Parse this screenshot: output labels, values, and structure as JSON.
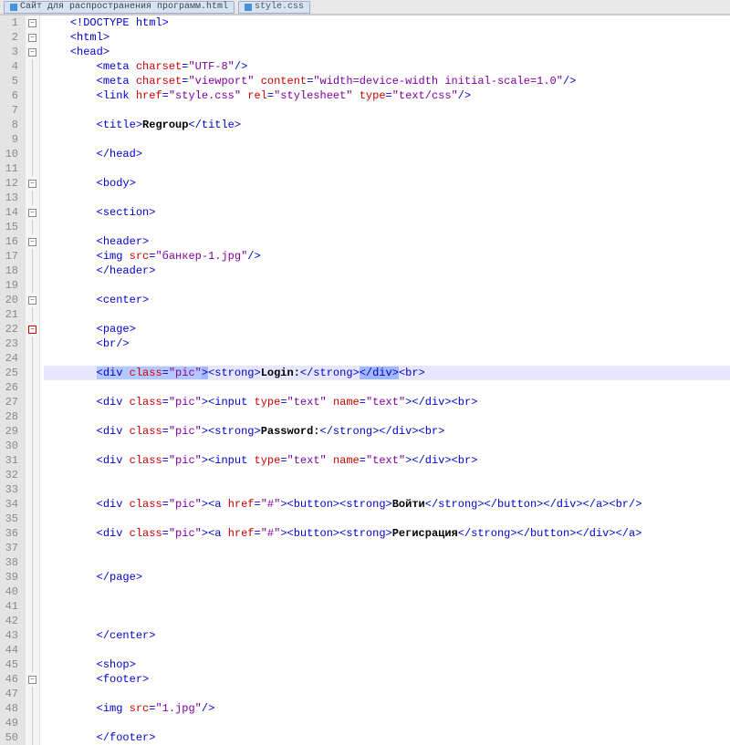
{
  "tabs": [
    {
      "label": "Сайт для распространения программ.html",
      "active": false
    },
    {
      "label": "style.css",
      "active": true
    }
  ],
  "lineStart": 1,
  "lineEnd": 50,
  "highlightedLine": 25,
  "foldMarkers": {
    "1": "expand",
    "2": "expand",
    "3": "expand",
    "12": "expand",
    "14": "expand",
    "16": "expand",
    "20": "expand",
    "22": "collapse",
    "46": "expand"
  },
  "selection": {
    "line": 25,
    "segments": [
      "<div",
      " ",
      "class",
      "=",
      "\"pic\"",
      ">",
      "</div>"
    ]
  },
  "code": [
    {
      "n": 1,
      "tokens": [
        [
          "tag",
          "<!DOCTYPE html>"
        ]
      ],
      "indent": 0
    },
    {
      "n": 2,
      "tokens": [
        [
          "tag",
          "<html>"
        ]
      ],
      "indent": 0
    },
    {
      "n": 3,
      "tokens": [
        [
          "tag",
          "<head>"
        ]
      ],
      "indent": 0
    },
    {
      "n": 4,
      "tokens": [
        [
          "tag",
          "<meta "
        ],
        [
          "attr",
          "charset"
        ],
        [
          "tag",
          "="
        ],
        [
          "str",
          "\"UTF-8\""
        ],
        [
          "tag",
          "/>"
        ]
      ],
      "indent": 2
    },
    {
      "n": 5,
      "tokens": [
        [
          "tag",
          "<meta "
        ],
        [
          "attr",
          "charset"
        ],
        [
          "tag",
          "="
        ],
        [
          "str",
          "\"viewport\" "
        ],
        [
          "attr",
          "content"
        ],
        [
          "tag",
          "="
        ],
        [
          "str",
          "\"width=device-width initial-scale=1.0\""
        ],
        [
          "tag",
          "/>"
        ]
      ],
      "indent": 2
    },
    {
      "n": 6,
      "tokens": [
        [
          "tag",
          "<link "
        ],
        [
          "attr",
          "href"
        ],
        [
          "tag",
          "="
        ],
        [
          "str",
          "\"style.css\" "
        ],
        [
          "attr",
          "rel"
        ],
        [
          "tag",
          "="
        ],
        [
          "str",
          "\"stylesheet\" "
        ],
        [
          "attr",
          "type"
        ],
        [
          "tag",
          "="
        ],
        [
          "str",
          "\"text/css\""
        ],
        [
          "tag",
          "/>"
        ]
      ],
      "indent": 2
    },
    {
      "n": 7,
      "tokens": [],
      "indent": 0
    },
    {
      "n": 8,
      "tokens": [
        [
          "tag",
          "<title>"
        ],
        [
          "txt",
          "Regroup"
        ],
        [
          "tag",
          "</title>"
        ]
      ],
      "indent": 2
    },
    {
      "n": 9,
      "tokens": [],
      "indent": 0
    },
    {
      "n": 10,
      "tokens": [
        [
          "tag",
          "</head>"
        ]
      ],
      "indent": 2
    },
    {
      "n": 11,
      "tokens": [],
      "indent": 0
    },
    {
      "n": 12,
      "tokens": [
        [
          "tag",
          "<body>"
        ]
      ],
      "indent": 2
    },
    {
      "n": 13,
      "tokens": [],
      "indent": 0
    },
    {
      "n": 14,
      "tokens": [
        [
          "tag",
          "<section>"
        ]
      ],
      "indent": 2
    },
    {
      "n": 15,
      "tokens": [],
      "indent": 0
    },
    {
      "n": 16,
      "tokens": [
        [
          "tag",
          "<header>"
        ]
      ],
      "indent": 2
    },
    {
      "n": 17,
      "tokens": [
        [
          "tag",
          "<img "
        ],
        [
          "attr",
          "src"
        ],
        [
          "tag",
          "="
        ],
        [
          "str",
          "\"банкер-1.jpg\""
        ],
        [
          "tag",
          "/>"
        ]
      ],
      "indent": 2
    },
    {
      "n": 18,
      "tokens": [
        [
          "tag",
          "</header>"
        ]
      ],
      "indent": 2
    },
    {
      "n": 19,
      "tokens": [],
      "indent": 0
    },
    {
      "n": 20,
      "tokens": [
        [
          "tag",
          "<center>"
        ]
      ],
      "indent": 2
    },
    {
      "n": 21,
      "tokens": [],
      "indent": 0
    },
    {
      "n": 22,
      "tokens": [
        [
          "tag",
          "<page>"
        ]
      ],
      "indent": 2
    },
    {
      "n": 23,
      "tokens": [
        [
          "tag",
          "<br/>"
        ]
      ],
      "indent": 2
    },
    {
      "n": 24,
      "tokens": [],
      "indent": 0
    },
    {
      "n": 25,
      "tokens": [
        [
          "sel_div_open",
          "<div "
        ],
        [
          "sel_attr",
          "class"
        ],
        [
          "sel_eq",
          "="
        ],
        [
          "sel_str",
          "\"pic\""
        ],
        [
          "sel_close",
          ">"
        ],
        [
          "tag",
          "<strong>"
        ],
        [
          "txt",
          "Login:"
        ],
        [
          "tag",
          "</strong>"
        ],
        [
          "sel_divclose",
          "</div>"
        ],
        [
          "tag",
          "<br>"
        ]
      ],
      "indent": 2,
      "highlight": true
    },
    {
      "n": 26,
      "tokens": [],
      "indent": 0
    },
    {
      "n": 27,
      "tokens": [
        [
          "tag",
          "<div "
        ],
        [
          "attr",
          "class"
        ],
        [
          "tag",
          "="
        ],
        [
          "str",
          "\"pic\""
        ],
        [
          "tag",
          ">"
        ],
        [
          "tag",
          "<input "
        ],
        [
          "attr",
          "type"
        ],
        [
          "tag",
          "="
        ],
        [
          "str",
          "\"text\" "
        ],
        [
          "attr",
          "name"
        ],
        [
          "tag",
          "="
        ],
        [
          "str",
          "\"text\""
        ],
        [
          "tag",
          "></div><br>"
        ]
      ],
      "indent": 2
    },
    {
      "n": 28,
      "tokens": [],
      "indent": 0
    },
    {
      "n": 29,
      "tokens": [
        [
          "tag",
          "<div "
        ],
        [
          "attr",
          "class"
        ],
        [
          "tag",
          "="
        ],
        [
          "str",
          "\"pic\""
        ],
        [
          "tag",
          ">"
        ],
        [
          "tag",
          "<strong>"
        ],
        [
          "txt",
          "Password:"
        ],
        [
          "tag",
          "</strong></div><br>"
        ]
      ],
      "indent": 2
    },
    {
      "n": 30,
      "tokens": [],
      "indent": 0
    },
    {
      "n": 31,
      "tokens": [
        [
          "tag",
          "<div "
        ],
        [
          "attr",
          "class"
        ],
        [
          "tag",
          "="
        ],
        [
          "str",
          "\"pic\""
        ],
        [
          "tag",
          ">"
        ],
        [
          "tag",
          "<input "
        ],
        [
          "attr",
          "type"
        ],
        [
          "tag",
          "="
        ],
        [
          "str",
          "\"text\" "
        ],
        [
          "attr",
          "name"
        ],
        [
          "tag",
          "="
        ],
        [
          "str",
          "\"text\""
        ],
        [
          "tag",
          "></div><br>"
        ]
      ],
      "indent": 2
    },
    {
      "n": 32,
      "tokens": [],
      "indent": 0
    },
    {
      "n": 33,
      "tokens": [],
      "indent": 0
    },
    {
      "n": 34,
      "tokens": [
        [
          "tag",
          "<div "
        ],
        [
          "attr",
          "class"
        ],
        [
          "tag",
          "="
        ],
        [
          "str",
          "\"pic\""
        ],
        [
          "tag",
          ">"
        ],
        [
          "tag",
          "<a "
        ],
        [
          "attr",
          "href"
        ],
        [
          "tag",
          "="
        ],
        [
          "str",
          "\"#\""
        ],
        [
          "tag",
          ">"
        ],
        [
          "tag",
          "<button><strong>"
        ],
        [
          "txt",
          "Войти"
        ],
        [
          "tag",
          "</strong></button></div></a><br/>"
        ]
      ],
      "indent": 2
    },
    {
      "n": 35,
      "tokens": [],
      "indent": 0
    },
    {
      "n": 36,
      "tokens": [
        [
          "tag",
          "<div "
        ],
        [
          "attr",
          "class"
        ],
        [
          "tag",
          "="
        ],
        [
          "str",
          "\"pic\""
        ],
        [
          "tag",
          ">"
        ],
        [
          "tag",
          "<a "
        ],
        [
          "attr",
          "href"
        ],
        [
          "tag",
          "="
        ],
        [
          "str",
          "\"#\""
        ],
        [
          "tag",
          ">"
        ],
        [
          "tag",
          "<button><strong>"
        ],
        [
          "txt",
          "Регисрация"
        ],
        [
          "tag",
          "</strong></button></div></a>"
        ]
      ],
      "indent": 2
    },
    {
      "n": 37,
      "tokens": [],
      "indent": 0
    },
    {
      "n": 38,
      "tokens": [],
      "indent": 0
    },
    {
      "n": 39,
      "tokens": [
        [
          "tag",
          "</page>"
        ]
      ],
      "indent": 2
    },
    {
      "n": 40,
      "tokens": [],
      "indent": 0
    },
    {
      "n": 41,
      "tokens": [],
      "indent": 0
    },
    {
      "n": 42,
      "tokens": [],
      "indent": 0
    },
    {
      "n": 43,
      "tokens": [
        [
          "tag",
          "</center>"
        ]
      ],
      "indent": 2
    },
    {
      "n": 44,
      "tokens": [],
      "indent": 0
    },
    {
      "n": 45,
      "tokens": [
        [
          "tag",
          "<shop>"
        ]
      ],
      "indent": 2
    },
    {
      "n": 46,
      "tokens": [
        [
          "tag",
          "<footer>"
        ]
      ],
      "indent": 2
    },
    {
      "n": 47,
      "tokens": [],
      "indent": 0
    },
    {
      "n": 48,
      "tokens": [
        [
          "tag",
          "<img "
        ],
        [
          "attr",
          "src"
        ],
        [
          "tag",
          "="
        ],
        [
          "str",
          "\"1.jpg\""
        ],
        [
          "tag",
          "/>"
        ]
      ],
      "indent": 2
    },
    {
      "n": 49,
      "tokens": [],
      "indent": 0
    },
    {
      "n": 50,
      "tokens": [
        [
          "tag",
          "</footer>"
        ]
      ],
      "indent": 2
    }
  ]
}
